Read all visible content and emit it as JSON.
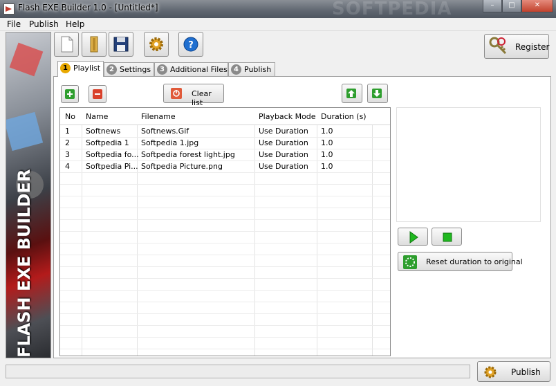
{
  "window": {
    "title": "Flash EXE Builder 1.0 - [Untitled*]",
    "watermark": "SOFTPEDIA"
  },
  "menu": [
    "File",
    "Publish",
    "Help"
  ],
  "sidebar": {
    "brand_text": "FLASH EXE BUILDER"
  },
  "toolbar": {
    "icons": [
      "new-document-icon",
      "open-folder-icon",
      "save-icon",
      "settings-gear-icon",
      "help-icon"
    ],
    "register_label": "Register"
  },
  "tabs": [
    {
      "num": "1",
      "label": "Playlist"
    },
    {
      "num": "2",
      "label": "Settings"
    },
    {
      "num": "3",
      "label": "Additional Files"
    },
    {
      "num": "4",
      "label": "Publish"
    }
  ],
  "playlist": {
    "clear_label": "Clear list",
    "columns": [
      "No",
      "Name",
      "Filename",
      "Playback Mode",
      "Duration (s)"
    ],
    "rows": [
      {
        "no": "1",
        "name": "Softnews",
        "filename": "Softnews.Gif",
        "mode": "Use Duration",
        "duration": "1.0"
      },
      {
        "no": "2",
        "name": "Softpedia 1",
        "filename": "Softpedia 1.jpg",
        "mode": "Use Duration",
        "duration": "1.0"
      },
      {
        "no": "3",
        "name": "Softpedia fo...",
        "filename": "Softpedia forest light.jpg",
        "mode": "Use Duration",
        "duration": "1.0"
      },
      {
        "no": "4",
        "name": "Softpedia Pi...",
        "filename": "Softpedia Picture.png",
        "mode": "Use Duration",
        "duration": "1.0"
      }
    ]
  },
  "preview": {
    "reset_label": "Reset duration to original"
  },
  "footer": {
    "publish_label": "Publish"
  },
  "colors": {
    "accent": "#e8a800",
    "add": "#2e9e2e",
    "remove": "#d9412b",
    "play": "#1fb81f"
  }
}
